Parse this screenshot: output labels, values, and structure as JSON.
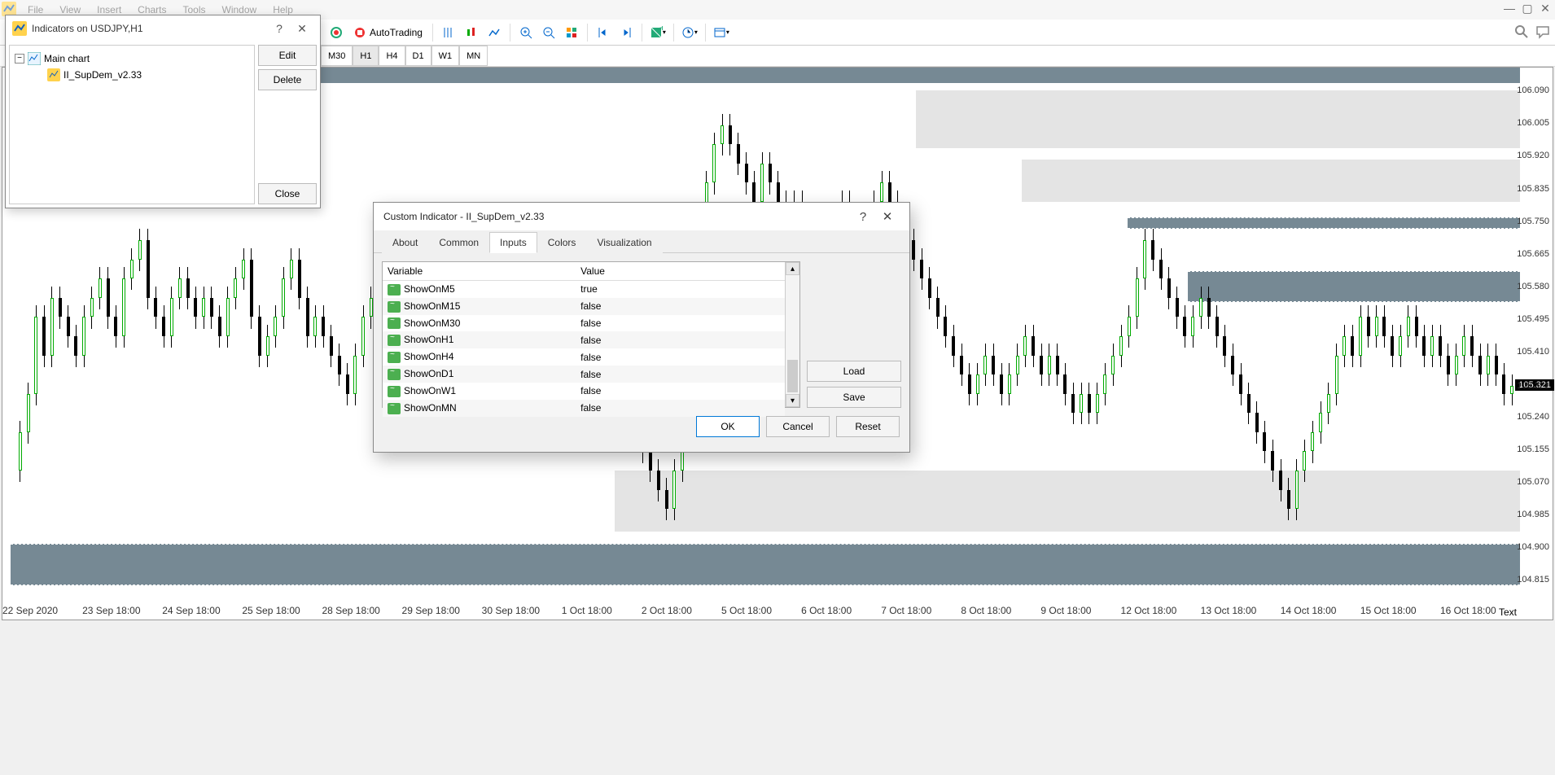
{
  "menu": {
    "items": [
      "File",
      "View",
      "Insert",
      "Charts",
      "Tools",
      "Window",
      "Help"
    ]
  },
  "toolbar": {
    "autotrading": "AutoTrading"
  },
  "timeframes": {
    "items": [
      "M30",
      "H1",
      "H4",
      "D1",
      "W1",
      "MN"
    ],
    "active": "H1"
  },
  "price_labels": [
    "106.090",
    "106.005",
    "105.920",
    "105.835",
    "105.750",
    "105.665",
    "105.580",
    "105.495",
    "105.410",
    "105.321",
    "105.240",
    "105.155",
    "105.070",
    "104.985",
    "104.900",
    "104.815"
  ],
  "current_price": "105.321",
  "time_labels": [
    "22 Sep 2020",
    "23 Sep 18:00",
    "24 Sep 18:00",
    "25 Sep 18:00",
    "28 Sep 18:00",
    "29 Sep 18:00",
    "30 Sep 18:00",
    "1 Oct 18:00",
    "2 Oct 18:00",
    "5 Oct 18:00",
    "6 Oct 18:00",
    "7 Oct 18:00",
    "8 Oct 18:00",
    "9 Oct 18:00",
    "12 Oct 18:00",
    "13 Oct 18:00",
    "14 Oct 18:00",
    "15 Oct 18:00",
    "16 Oct 18:00"
  ],
  "text_label": "Text",
  "ind_dialog": {
    "title": "Indicators on USDJPY,H1",
    "tree_root": "Main chart",
    "tree_child": "II_SupDem_v2.33",
    "btn_edit": "Edit",
    "btn_delete": "Delete",
    "btn_close": "Close"
  },
  "ci_dialog": {
    "title": "Custom Indicator - II_SupDem_v2.33",
    "tabs": [
      "About",
      "Common",
      "Inputs",
      "Colors",
      "Visualization"
    ],
    "active_tab": "Inputs",
    "col_variable": "Variable",
    "col_value": "Value",
    "rows": [
      {
        "var": "ShowOnM5",
        "val": "true"
      },
      {
        "var": "ShowOnM15",
        "val": "false"
      },
      {
        "var": "ShowOnM30",
        "val": "false"
      },
      {
        "var": "ShowOnH1",
        "val": "false"
      },
      {
        "var": "ShowOnH4",
        "val": "false"
      },
      {
        "var": "ShowOnD1",
        "val": "false"
      },
      {
        "var": "ShowOnW1",
        "val": "false"
      },
      {
        "var": "ShowOnMN",
        "val": "false"
      }
    ],
    "btn_load": "Load",
    "btn_save": "Save",
    "btn_ok": "OK",
    "btn_cancel": "Cancel",
    "btn_reset": "Reset"
  },
  "chart_data": {
    "type": "candlestick",
    "symbol": "USDJPY",
    "timeframe": "H1",
    "y_range": [
      104.75,
      106.15
    ],
    "zones": [
      {
        "kind": "supply",
        "top": 106.15,
        "bottom": 106.11,
        "from": 0,
        "color": "blue"
      },
      {
        "kind": "supply",
        "top": 106.09,
        "bottom": 105.94,
        "from": 0.6,
        "color": "grey"
      },
      {
        "kind": "supply",
        "top": 105.91,
        "bottom": 105.8,
        "from": 0.67,
        "color": "grey"
      },
      {
        "kind": "supply",
        "top": 105.76,
        "bottom": 105.73,
        "from": 0.74,
        "color": "blue-dashed"
      },
      {
        "kind": "supply",
        "top": 105.62,
        "bottom": 105.54,
        "from": 0.78,
        "color": "blue-dashed"
      },
      {
        "kind": "demand",
        "top": 105.1,
        "bottom": 104.94,
        "from": 0.4,
        "color": "grey"
      },
      {
        "kind": "demand",
        "top": 104.91,
        "bottom": 104.8,
        "from": 0.0,
        "color": "blue-dashed"
      }
    ],
    "note": "approximate candle OHLC omitted — visual recreation only"
  }
}
